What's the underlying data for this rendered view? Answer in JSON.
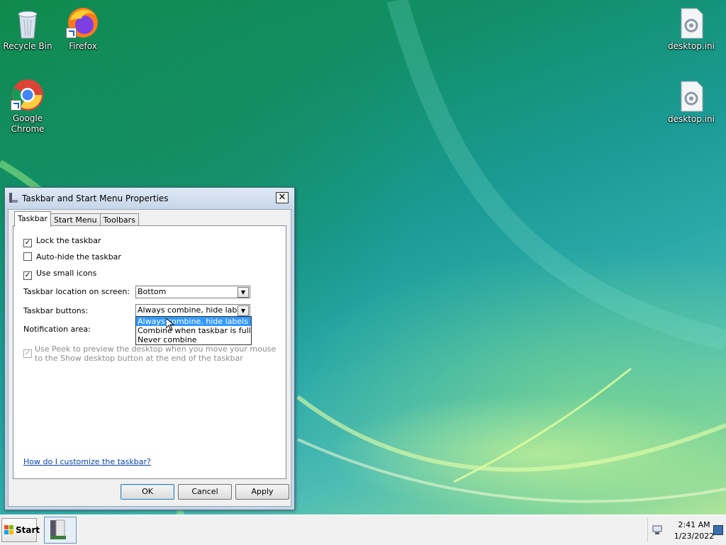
{
  "desktop": {
    "icons": [
      {
        "label": "Recycle Bin"
      },
      {
        "label": "Firefox"
      },
      {
        "label": "Google Chrome"
      },
      {
        "label": "desktop.ini"
      },
      {
        "label": "desktop.ini"
      }
    ]
  },
  "dialog": {
    "title": "Taskbar and Start Menu Properties",
    "close_glyph": "✕",
    "tabs": [
      {
        "label": "Taskbar",
        "active": true
      },
      {
        "label": "Start Menu",
        "active": false
      },
      {
        "label": "Toolbars",
        "active": false
      }
    ],
    "checkboxes": [
      {
        "label": "Lock the taskbar",
        "checked": true
      },
      {
        "label": "Auto-hide the taskbar",
        "checked": false
      },
      {
        "label": "Use small icons",
        "checked": true
      }
    ],
    "location_label": "Taskbar location on screen:",
    "location_value": "Bottom",
    "buttons_label": "Taskbar buttons:",
    "buttons_value": "Always combine, hide labels",
    "buttons_options": [
      {
        "label": "Always combine, hide labels",
        "selected": true
      },
      {
        "label": "Combine when taskbar is full",
        "selected": false
      },
      {
        "label": "Never combine",
        "selected": false
      }
    ],
    "notification_label": "Notification area:",
    "peek_label": "Use Peek to preview the desktop when you move your mouse to the Show desktop button at the end of the taskbar",
    "peek_checked": true,
    "help_link": "How do I customize the taskbar?",
    "ok_label": "OK",
    "cancel_label": "Cancel",
    "apply_label": "Apply",
    "check_glyph": "✓"
  },
  "taskbar": {
    "start_label": "Start",
    "time": "2:41 AM",
    "date": "1/23/2022"
  },
  "colors": {
    "selection": "#3399ff",
    "link": "#0645ad"
  }
}
